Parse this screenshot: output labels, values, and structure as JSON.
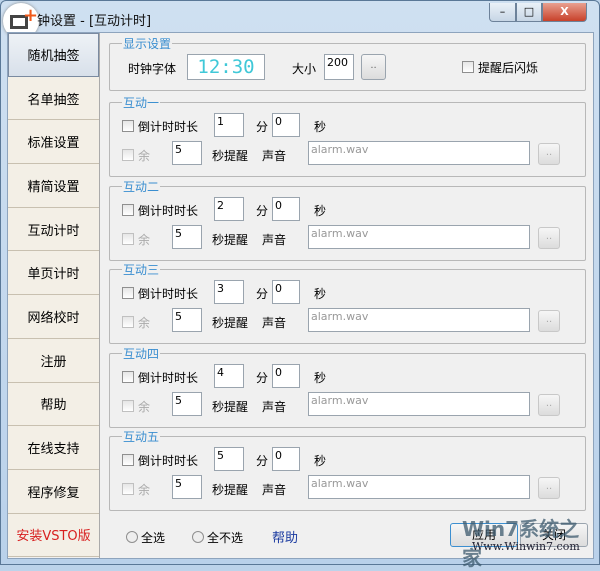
{
  "window": {
    "title": "钟设置 - [互动计时]",
    "minimize": "–",
    "maximize": "□",
    "close": "X"
  },
  "sidebar": {
    "items": [
      {
        "label": "随机抽签",
        "active": true
      },
      {
        "label": "名单抽签"
      },
      {
        "label": "标准设置"
      },
      {
        "label": "精简设置"
      },
      {
        "label": "互动计时"
      },
      {
        "label": "单页计时"
      },
      {
        "label": "网络校时"
      },
      {
        "label": "注册"
      },
      {
        "label": "帮助"
      },
      {
        "label": "在线支持"
      },
      {
        "label": "程序修复"
      },
      {
        "label": "安装VSTO版",
        "color": "#d82020"
      }
    ]
  },
  "display": {
    "legend": "显示设置",
    "font_label": "时钟字体",
    "clock_preview": "12:30",
    "size_label": "大小",
    "size_value": "200",
    "browse": "..",
    "flash_label": "提醒后闪烁"
  },
  "groups": [
    {
      "legend": "互动一",
      "countdown_label": "倒计时时长",
      "minutes": "1",
      "min_label": "分",
      "seconds": "0",
      "sec_label": "秒",
      "remain_label": "余",
      "remind_seconds": "5",
      "remind_label": "秒提醒",
      "sound_label": "声音",
      "sound_file": "alarm.wav",
      "browse": ".."
    },
    {
      "legend": "互动二",
      "countdown_label": "倒计时时长",
      "minutes": "2",
      "min_label": "分",
      "seconds": "0",
      "sec_label": "秒",
      "remain_label": "余",
      "remind_seconds": "5",
      "remind_label": "秒提醒",
      "sound_label": "声音",
      "sound_file": "alarm.wav",
      "browse": ".."
    },
    {
      "legend": "互动三",
      "countdown_label": "倒计时时长",
      "minutes": "3",
      "min_label": "分",
      "seconds": "0",
      "sec_label": "秒",
      "remain_label": "余",
      "remind_seconds": "5",
      "remind_label": "秒提醒",
      "sound_label": "声音",
      "sound_file": "alarm.wav",
      "browse": ".."
    },
    {
      "legend": "互动四",
      "countdown_label": "倒计时时长",
      "minutes": "4",
      "min_label": "分",
      "seconds": "0",
      "sec_label": "秒",
      "remain_label": "余",
      "remind_seconds": "5",
      "remind_label": "秒提醒",
      "sound_label": "声音",
      "sound_file": "alarm.wav",
      "browse": ".."
    },
    {
      "legend": "互动五",
      "countdown_label": "倒计时时长",
      "minutes": "5",
      "min_label": "分",
      "seconds": "0",
      "sec_label": "秒",
      "remain_label": "余",
      "remind_seconds": "5",
      "remind_label": "秒提醒",
      "sound_label": "声音",
      "sound_file": "alarm.wav",
      "browse": ".."
    }
  ],
  "footer": {
    "select_all": "全选",
    "select_none": "全不选",
    "help": "帮助",
    "apply": "应用",
    "close": "关闭"
  },
  "watermark": {
    "brand": "Win7系统之家",
    "url": "Www.Winwin7.com"
  },
  "colors": {
    "accent": "#3a8ed0",
    "clock": "#40c8d8",
    "red": "#d82020",
    "link": "#1a3aa0"
  }
}
